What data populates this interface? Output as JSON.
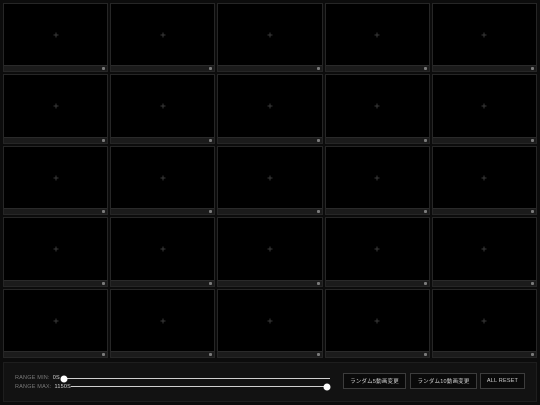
{
  "grid": {
    "rows": 5,
    "cols": 5,
    "empty_cell_icon": "plus-icon"
  },
  "controls": {
    "range_min": {
      "label": "RANGE MIN:",
      "value": "0S",
      "position": 0.0
    },
    "range_max": {
      "label": "RANGE MAX:",
      "value": "1150S",
      "position": 1.0
    },
    "buttons": {
      "random5": "ランダム5動画変更",
      "random10": "ランダム10動画変更",
      "reset": "ALL RESET"
    }
  },
  "colors": {
    "background": "#0c0c0c",
    "cell": "#000000",
    "slider": "#ffffff"
  }
}
